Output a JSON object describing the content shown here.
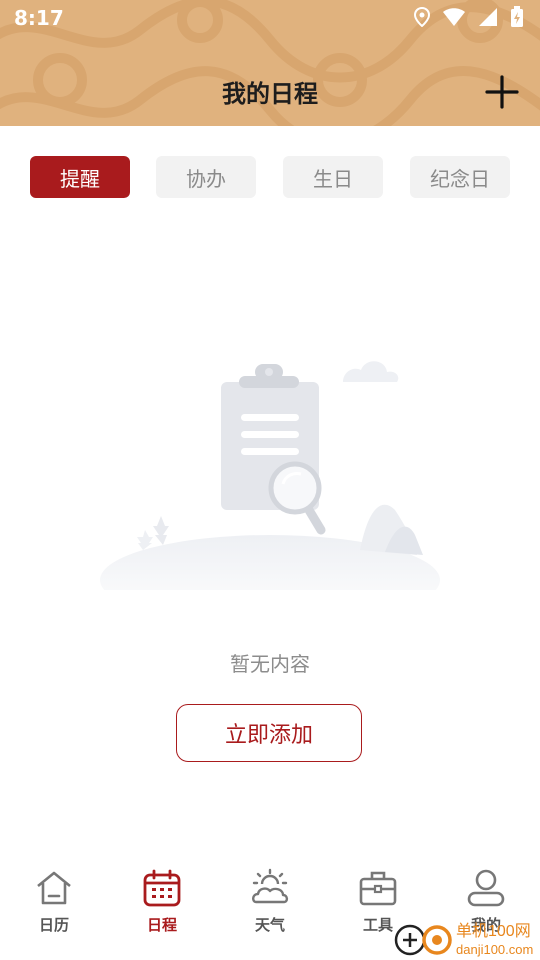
{
  "status_bar": {
    "time": "8:17"
  },
  "header": {
    "title": "我的日程"
  },
  "tabs": [
    {
      "label": "提醒",
      "active": true
    },
    {
      "label": "协办",
      "active": false
    },
    {
      "label": "生日",
      "active": false
    },
    {
      "label": "纪念日",
      "active": false
    }
  ],
  "empty_state": {
    "message": "暂无内容",
    "action_label": "立即添加"
  },
  "bottom_nav": [
    {
      "label": "日历",
      "icon": "home-icon",
      "active": false
    },
    {
      "label": "日程",
      "icon": "calendar-icon",
      "active": true
    },
    {
      "label": "天气",
      "icon": "weather-icon",
      "active": false
    },
    {
      "label": "工具",
      "icon": "toolbox-icon",
      "active": false
    },
    {
      "label": "我的",
      "icon": "user-icon",
      "active": false
    }
  ],
  "watermark": {
    "site_cn": "单机100网",
    "site_url": "danji100.com"
  },
  "colors": {
    "accent": "#a91b1d",
    "header_bg": "#e0b27e",
    "inactive_tab_bg": "#f2f2f2"
  }
}
